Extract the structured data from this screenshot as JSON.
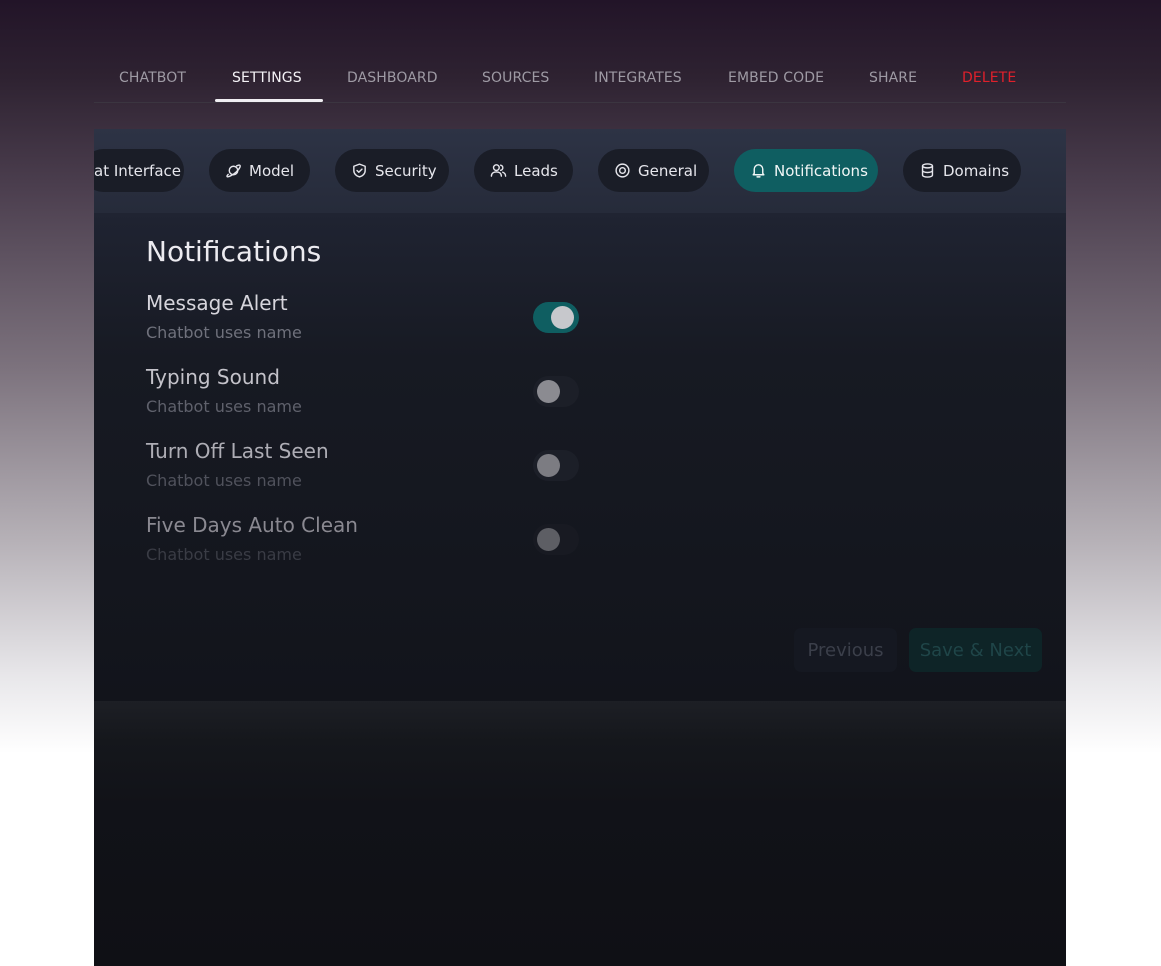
{
  "top_tabs": {
    "chatbot": "CHATBOT",
    "settings": "SETTINGS",
    "dashboard": "DASHBOARD",
    "sources": "SOURCES",
    "integrates": "INTEGRATES",
    "embed_code": "EMBED CODE",
    "share": "SHARE",
    "delete": "DELETE",
    "active": "SETTINGS",
    "delete_color": "#e0202b"
  },
  "settings_tabs": {
    "chat_interface": "at Interface",
    "model": "Model",
    "security": "Security",
    "leads": "Leads",
    "general": "General",
    "notifications": "Notifications",
    "domains": "Domains",
    "active": "Notifications",
    "accent_color": "#0f5e61"
  },
  "notifications": {
    "title": "Notifications",
    "items": [
      {
        "title": "Message Alert",
        "subtitle": "Chatbot uses name",
        "enabled": true
      },
      {
        "title": "Typing Sound",
        "subtitle": "Chatbot uses name",
        "enabled": false
      },
      {
        "title": "Turn Off Last Seen",
        "subtitle": "Chatbot uses name",
        "enabled": false
      },
      {
        "title": "Five Days Auto Clean",
        "subtitle": "Chatbot uses name",
        "enabled": false
      }
    ]
  },
  "actions": {
    "previous": "Previous",
    "save_next": "Save & Next"
  }
}
